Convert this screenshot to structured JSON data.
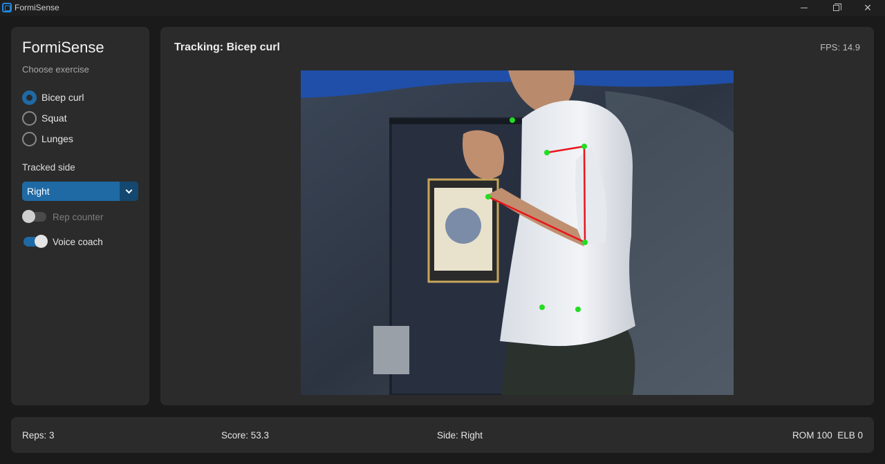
{
  "window": {
    "title": "FormiSense"
  },
  "sidebar": {
    "brand": "FormiSense",
    "choose_label": "Choose exercise",
    "exercises": [
      {
        "label": "Bicep curl",
        "checked": true
      },
      {
        "label": "Squat",
        "checked": false
      },
      {
        "label": "Lunges",
        "checked": false
      }
    ],
    "tracked_side_label": "Tracked side",
    "tracked_side_value": "Right",
    "rep_counter": {
      "label": "Rep counter",
      "on": false
    },
    "voice_coach": {
      "label": "Voice coach",
      "on": true
    }
  },
  "main": {
    "tracking_title": "Tracking: Bicep curl",
    "fps": "FPS: 14.9"
  },
  "status": {
    "reps": "Reps: 3",
    "score": "Score: 53.3",
    "side": "Side: Right",
    "metrics": "ROM 100  ELB 0"
  },
  "colors": {
    "accent": "#1f6aa5",
    "skeleton_line": "#e8141c",
    "keypoint": "#22dd22"
  },
  "icons": [
    "app-logo-icon",
    "minimize-icon",
    "maximize-icon",
    "close-icon",
    "chevron-down-icon"
  ]
}
